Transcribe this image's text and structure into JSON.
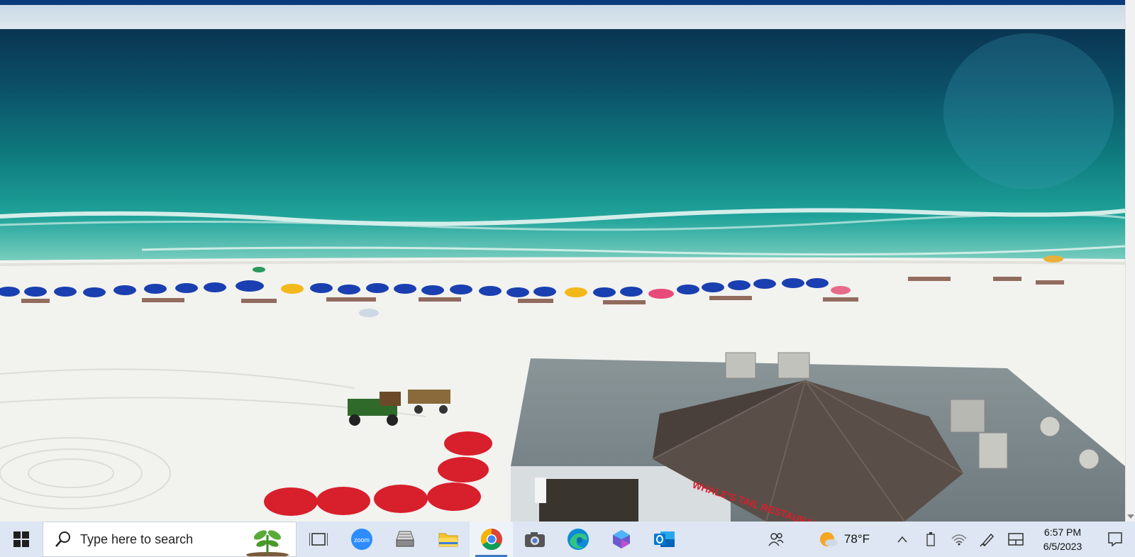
{
  "taskbar": {
    "search_placeholder": "Type here to search",
    "pinned": [
      {
        "name": "task-view-icon"
      },
      {
        "name": "zoom-icon",
        "label": "zoom"
      },
      {
        "name": "scanner-icon"
      },
      {
        "name": "file-explorer-icon"
      },
      {
        "name": "chrome-icon",
        "active": true
      },
      {
        "name": "camera-icon"
      },
      {
        "name": "edge-icon"
      },
      {
        "name": "copilot-icon"
      },
      {
        "name": "outlook-icon"
      }
    ],
    "weather": {
      "temp": "78°F",
      "icon": "partly-sunny-icon"
    },
    "clock": {
      "time": "6:57 PM",
      "date": "6/5/2023"
    }
  },
  "photo": {
    "sign_text": "WHALE'S TAIL RESTAURANT",
    "colors": {
      "ocean_deep": "#0b4c66",
      "ocean_shallow": "#1fa39a",
      "sand": "#f2f2ef",
      "umbrella_blue": "#1a3fb0",
      "umbrella_red": "#d81f2c",
      "roof": "#5a4e48"
    }
  }
}
